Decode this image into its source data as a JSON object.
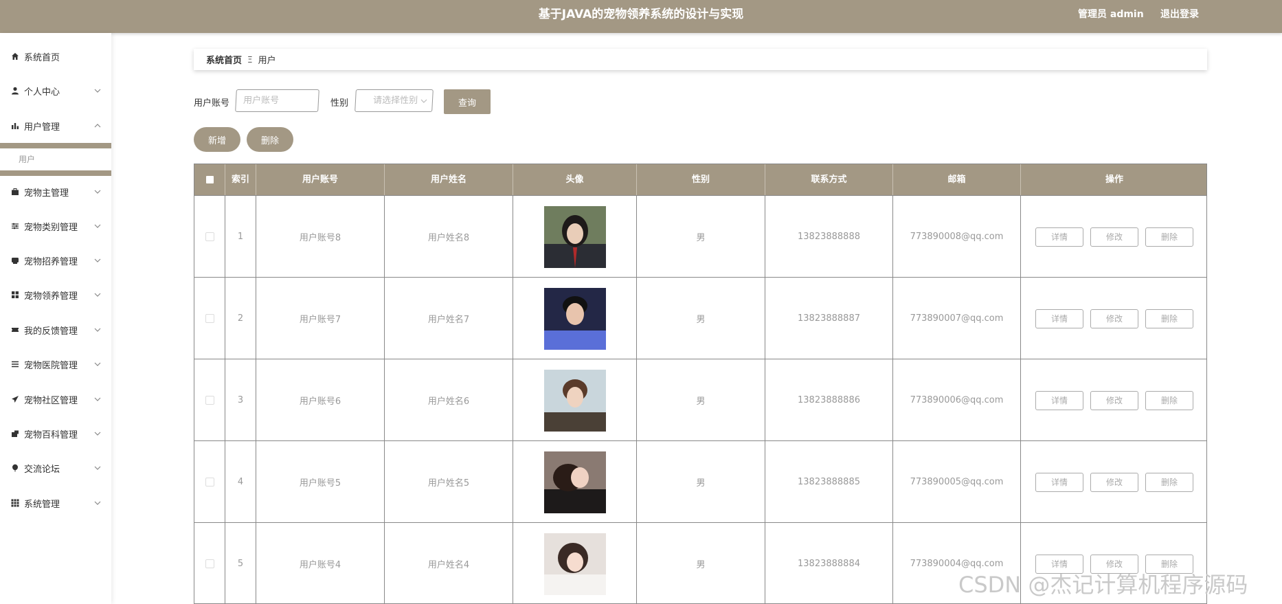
{
  "header": {
    "title": "基于JAVA的宠物领养系统的设计与实现",
    "admin_label": "管理员 admin",
    "logout_label": "退出登录"
  },
  "sidebar": {
    "items": [
      {
        "label": "系统首页",
        "icon": "home-icon",
        "expandable": false
      },
      {
        "label": "个人中心",
        "icon": "user-icon",
        "expandable": true
      },
      {
        "label": "用户管理",
        "icon": "bar-chart-icon",
        "expandable": true,
        "expanded": true
      },
      {
        "label": "宠物主管理",
        "icon": "briefcase-icon",
        "expandable": true
      },
      {
        "label": "宠物类别管理",
        "icon": "sliders-icon",
        "expandable": true
      },
      {
        "label": "宠物招养管理",
        "icon": "inbox-icon",
        "expandable": true
      },
      {
        "label": "宠物领养管理",
        "icon": "grid-icon",
        "expandable": true
      },
      {
        "label": "我的反馈管理",
        "icon": "ticket-icon",
        "expandable": true
      },
      {
        "label": "宠物医院管理",
        "icon": "list-icon",
        "expandable": true
      },
      {
        "label": "宠物社区管理",
        "icon": "send-icon",
        "expandable": true
      },
      {
        "label": "宠物百科管理",
        "icon": "book-icon",
        "expandable": true
      },
      {
        "label": "交流论坛",
        "icon": "balloon-icon",
        "expandable": true
      },
      {
        "label": "系统管理",
        "icon": "apps-icon",
        "expandable": true
      }
    ],
    "sub_item": "用户"
  },
  "breadcrumb": {
    "home": "系统首页",
    "separator": "Ξ",
    "current": "用户"
  },
  "search": {
    "account_label": "用户账号",
    "account_placeholder": "用户账号",
    "gender_label": "性别",
    "gender_placeholder": "请选择性别",
    "search_button": "查询"
  },
  "actions": {
    "add": "新增",
    "delete": "删除"
  },
  "table": {
    "columns": [
      "索引",
      "用户账号",
      "用户姓名",
      "头像",
      "性别",
      "联系方式",
      "邮箱",
      "操作"
    ],
    "rows": [
      {
        "index": "1",
        "account": "用户账号8",
        "name": "用户姓名8",
        "gender": "男",
        "phone": "13823888888",
        "email": "773890008@qq.com"
      },
      {
        "index": "2",
        "account": "用户账号7",
        "name": "用户姓名7",
        "gender": "男",
        "phone": "13823888887",
        "email": "773890007@qq.com"
      },
      {
        "index": "3",
        "account": "用户账号6",
        "name": "用户姓名6",
        "gender": "男",
        "phone": "13823888886",
        "email": "773890006@qq.com"
      },
      {
        "index": "4",
        "account": "用户账号5",
        "name": "用户姓名5",
        "gender": "男",
        "phone": "13823888885",
        "email": "773890005@qq.com"
      },
      {
        "index": "5",
        "account": "用户账号4",
        "name": "用户姓名4",
        "gender": "男",
        "phone": "13823888884",
        "email": "773890004@qq.com"
      }
    ],
    "row_actions": [
      "详情",
      "修改",
      "删除"
    ]
  },
  "watermark": "CSDN @杰记计算机程序源码",
  "colors": {
    "accent": "#a39884"
  }
}
